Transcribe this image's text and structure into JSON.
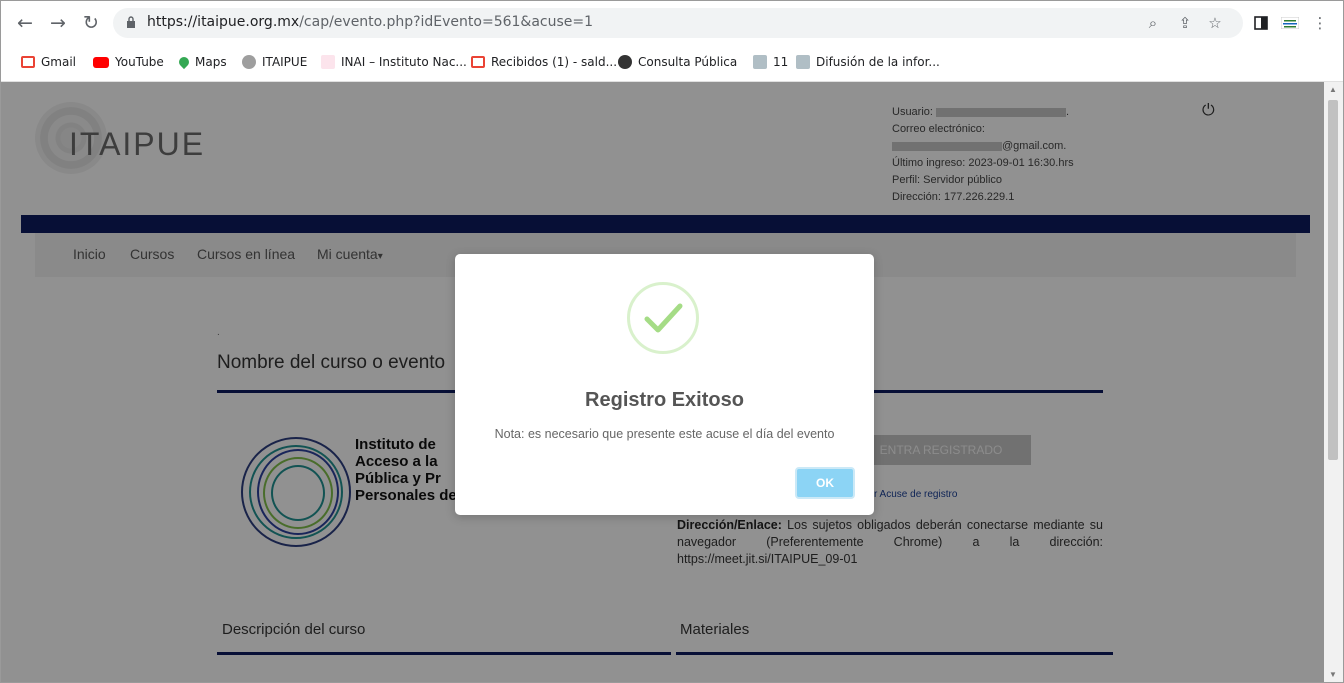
{
  "browser": {
    "url_domain": "https://itaipue.org.mx",
    "url_path": "/cap/evento.php?idEvento=561&acuse=1",
    "bookmarks": [
      {
        "label": "Gmail",
        "color": "#ea4335"
      },
      {
        "label": "YouTube",
        "color": "#ff0000"
      },
      {
        "label": "Maps",
        "color": "#34a853"
      },
      {
        "label": "ITAIPUE",
        "color": "#9e9e9e"
      },
      {
        "label": "INAI – Instituto Nac...",
        "color": "#c2185b"
      },
      {
        "label": "Recibidos (1) - sald...",
        "color": "#ea4335"
      },
      {
        "label": "Consulta Pública",
        "color": "#333333"
      },
      {
        "label": "11",
        "color": "#8d9aa6"
      },
      {
        "label": "Difusión de la infor...",
        "color": "#8d9aa6"
      }
    ]
  },
  "header": {
    "logo_text": "ITAIPUE",
    "user_label": "Usuario: ",
    "user_suffix": ".",
    "email_label": "Correo electrónico:",
    "email_suffix": "@gmail.com.",
    "last_login": "Último ingreso: 2023-09-01 16:30.hrs",
    "profile": "Perfil: Servidor público",
    "address": "Dirección: 177.226.229.1"
  },
  "menu": {
    "items": [
      "Inicio",
      "Cursos",
      "Cursos en línea",
      "Mi cuenta"
    ],
    "caret": "▾"
  },
  "course": {
    "dot": ".",
    "title": "Nombre del curso o evento",
    "institution_lines": [
      "Instituto de",
      "Acceso a la",
      "Pública y Pr",
      "Personales del Estado de Puebla"
    ],
    "register_button": "ENTRA REGISTRADO",
    "acuse_link": "r Acuse de registro",
    "direccion_label": "Dirección/Enlace:",
    "direccion_text": " Los sujetos obligados deberán conectarse mediante su navegador (Preferentemente Chrome) a la dirección: https://meet.jit.si/ITAIPUE_09-01",
    "description_title": "Descripción del curso",
    "materials_title": "Materiales"
  },
  "modal": {
    "title": "Registro Exitoso",
    "text": "Nota: es necesario que presente este acuse el día del evento",
    "ok_label": "OK",
    "icon": "success-check-icon",
    "accent_color": "#8cd4f5",
    "check_color": "#a5dc86"
  },
  "colors": {
    "navy": "#0c1a5a"
  }
}
